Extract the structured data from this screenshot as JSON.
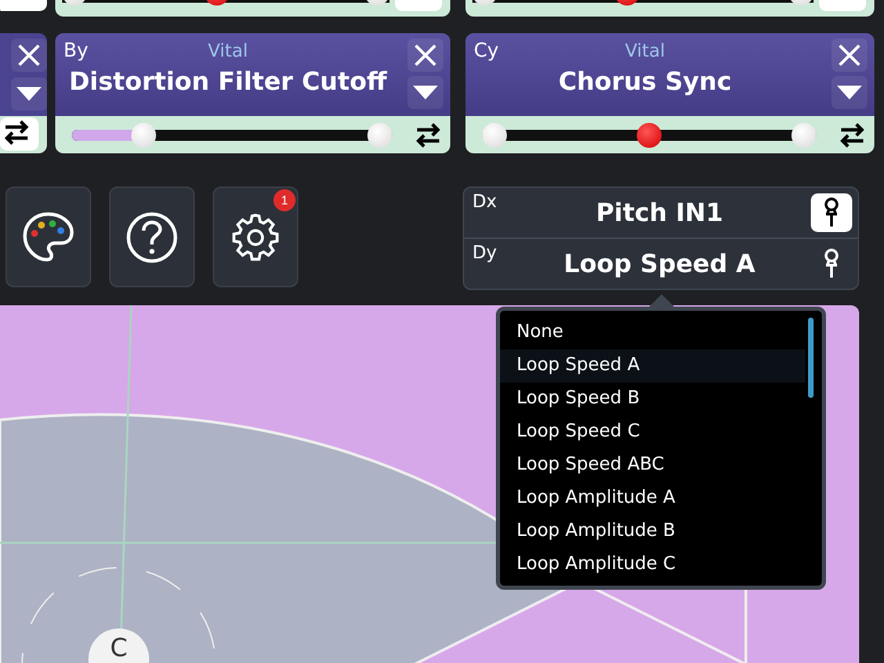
{
  "top_cards": [
    {
      "level": 0.47
    },
    {
      "level": 0.45
    }
  ],
  "cards": [
    {
      "axis": "By",
      "source": "Vital",
      "name": "Distortion Filter Cutoff",
      "kind": "fill",
      "level": 0.2
    },
    {
      "axis": "Cy",
      "source": "Vital",
      "name": "Chorus Sync",
      "kind": "marker",
      "level": 0.5
    }
  ],
  "tool_buttons": [
    {
      "kind": "palette"
    },
    {
      "kind": "help"
    },
    {
      "kind": "settings",
      "badge": "1"
    }
  ],
  "xy_panel": [
    {
      "axis": "Dx",
      "name": "Pitch IN1",
      "pinned": true
    },
    {
      "axis": "Dy",
      "name": "Loop Speed A",
      "pinned": false
    }
  ],
  "dropdown": [
    {
      "label": "None",
      "selected": false
    },
    {
      "label": "Loop Speed A",
      "selected": true
    },
    {
      "label": "Loop Speed B",
      "selected": false
    },
    {
      "label": "Loop Speed C",
      "selected": false
    },
    {
      "label": "Loop Speed ABC",
      "selected": false
    },
    {
      "label": "Loop Amplitude A",
      "selected": false
    },
    {
      "label": "Loop Amplitude B",
      "selected": false
    },
    {
      "label": "Loop Amplitude C",
      "selected": false
    }
  ],
  "pad": {
    "node": "C"
  }
}
